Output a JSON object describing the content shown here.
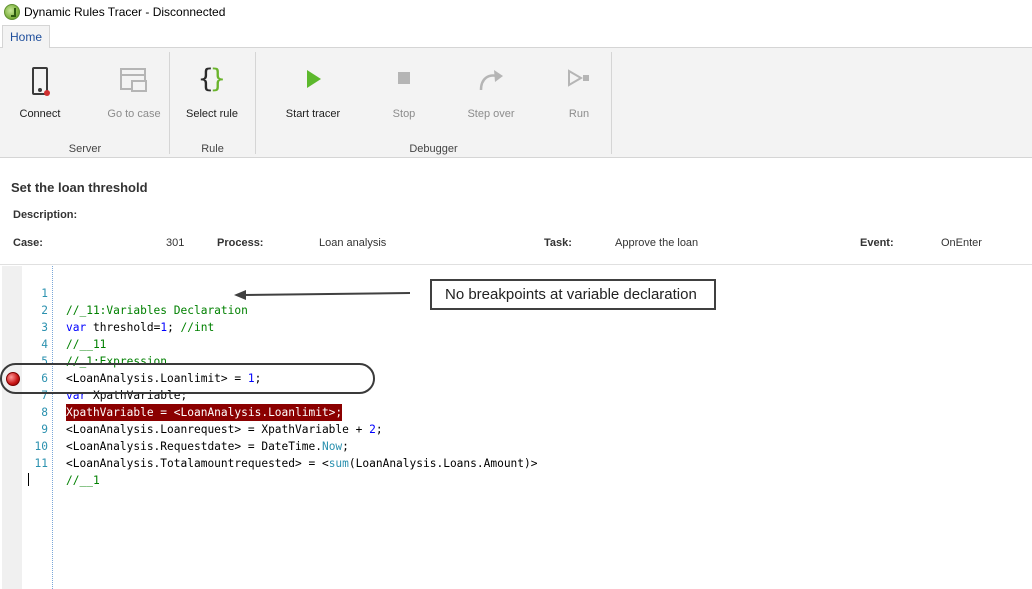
{
  "window": {
    "title": "Dynamic Rules Tracer - Disconnected"
  },
  "ribbon": {
    "tabs": [
      {
        "label": "Home",
        "active": true
      }
    ],
    "groups": [
      {
        "label": "Server",
        "buttons": [
          {
            "label": "Connect",
            "icon": "device-connect-icon",
            "enabled": true
          },
          {
            "label": "Go to case",
            "icon": "go-to-case-icon",
            "enabled": false
          }
        ]
      },
      {
        "label": "Rule",
        "buttons": [
          {
            "label": "Select rule",
            "icon": "curly-braces-icon",
            "enabled": true
          }
        ]
      },
      {
        "label": "Debugger",
        "buttons": [
          {
            "label": "Start tracer",
            "icon": "play-icon",
            "enabled": true
          },
          {
            "label": "Stop",
            "icon": "stop-icon",
            "enabled": false
          },
          {
            "label": "Step over",
            "icon": "step-over-icon",
            "enabled": false
          },
          {
            "label": "Run",
            "icon": "run-icon",
            "enabled": false
          }
        ]
      }
    ]
  },
  "rule": {
    "title": "Set the loan threshold",
    "description_label": "Description:",
    "case_label": "Case:",
    "case_value": "301",
    "process_label": "Process:",
    "process_value": "Loan analysis",
    "task_label": "Task:",
    "task_value": "Approve the loan",
    "event_label": "Event:",
    "event_value": "OnEnter"
  },
  "editor": {
    "breakpoint_line": 7,
    "lines": [
      {
        "num": "1",
        "text": "//_11:Variables Declaration"
      },
      {
        "num": "2",
        "text": "var threshold=1; //int"
      },
      {
        "num": "3",
        "text": "//__11"
      },
      {
        "num": "4",
        "text": "//_1:Expression"
      },
      {
        "num": "5",
        "text": "<LoanAnalysis.Loanlimit> = 1;"
      },
      {
        "num": "6",
        "text": "var XpathVariable;"
      },
      {
        "num": "7",
        "text": "XpathVariable = <LoanAnalysis.Loanlimit>;"
      },
      {
        "num": "8",
        "text": "<LoanAnalysis.Loanrequest> = XpathVariable + 2;"
      },
      {
        "num": "9",
        "text": "<LoanAnalysis.Requestdate> = DateTime.Now;"
      },
      {
        "num": "10",
        "text": "<LoanAnalysis.Totalamountrequested> = <sum(LoanAnalysis.Loans.Amount)>"
      },
      {
        "num": "11",
        "text": "//__1"
      }
    ]
  },
  "annotations": {
    "callout_text": "No breakpoints at variable declaration"
  },
  "colors": {
    "comment": "#008000",
    "keyword": "#0000ff",
    "line_number": "#2b91af",
    "breakpoint_highlight": "#8b0000",
    "tab_text": "#1e4e9c",
    "play_green": "#5cb82c"
  }
}
